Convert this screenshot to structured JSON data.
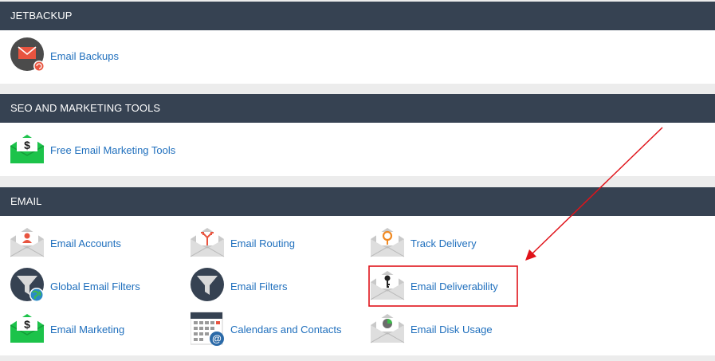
{
  "sections": {
    "jetbackup": {
      "title": "JETBACKUP",
      "items": [
        {
          "label": "Email Backups",
          "icon": "email-backup-icon"
        }
      ]
    },
    "seo": {
      "title": "SEO AND MARKETING TOOLS",
      "items": [
        {
          "label": "Free Email Marketing Tools",
          "icon": "dollar-envelope-icon"
        }
      ]
    },
    "email": {
      "title": "EMAIL",
      "items": [
        {
          "label": "Email Accounts",
          "icon": "user-envelope-icon"
        },
        {
          "label": "Email Routing",
          "icon": "routing-envelope-icon"
        },
        {
          "label": "Track Delivery",
          "icon": "location-envelope-icon"
        },
        {
          "label": "Global Email Filters",
          "icon": "global-filter-icon"
        },
        {
          "label": "Email Filters",
          "icon": "filter-icon"
        },
        {
          "label": "Email Deliverability",
          "icon": "key-envelope-icon"
        },
        {
          "label": "Email Marketing",
          "icon": "dollar-envelope-icon"
        },
        {
          "label": "Calendars and Contacts",
          "icon": "calendar-contacts-icon"
        },
        {
          "label": "Email Disk Usage",
          "icon": "disk-usage-envelope-icon"
        }
      ]
    }
  },
  "annotations": {
    "highlight_target": "Email Deliverability",
    "highlight_color": "#e0131a",
    "arrow_color": "#e0131a"
  },
  "colors": {
    "header_bg": "#364252",
    "link": "#1f6fbd",
    "page_bg": "#ececec"
  }
}
